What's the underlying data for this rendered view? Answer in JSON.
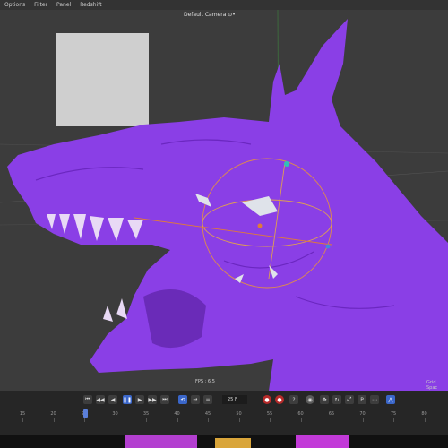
{
  "menu": {
    "items": [
      "Options",
      "Filter",
      "Panel",
      "Redshift"
    ]
  },
  "viewport": {
    "camera_label": "Default Camera ⊙•",
    "fps": "FPS : 6.5",
    "grid_label": "Grid Spac"
  },
  "timeline": {
    "frame_value": "25 F",
    "ticks": [
      "15",
      "20",
      "25",
      "30",
      "35",
      "40",
      "45",
      "50",
      "55",
      "60",
      "65",
      "70",
      "75",
      "80"
    ],
    "current_frame": 25
  },
  "colors": {
    "model": "#8a3fe6",
    "viewport_bg": "#3c3c3c",
    "accent": "#3a66c9",
    "gizmo": "#e08c4a"
  }
}
